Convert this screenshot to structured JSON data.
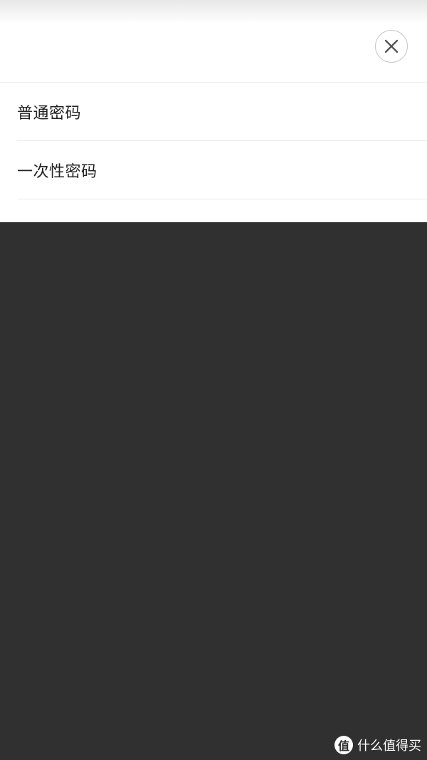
{
  "sheet": {
    "close_icon": "close-icon",
    "options": [
      {
        "label": "普通密码"
      },
      {
        "label": "一次性密码"
      }
    ]
  },
  "watermark": {
    "logo_glyph": "值",
    "text": "什么值得买"
  },
  "colors": {
    "overlay": "#303030",
    "sheet_background": "#ffffff",
    "divider": "#ececec",
    "text": "#222222"
  }
}
